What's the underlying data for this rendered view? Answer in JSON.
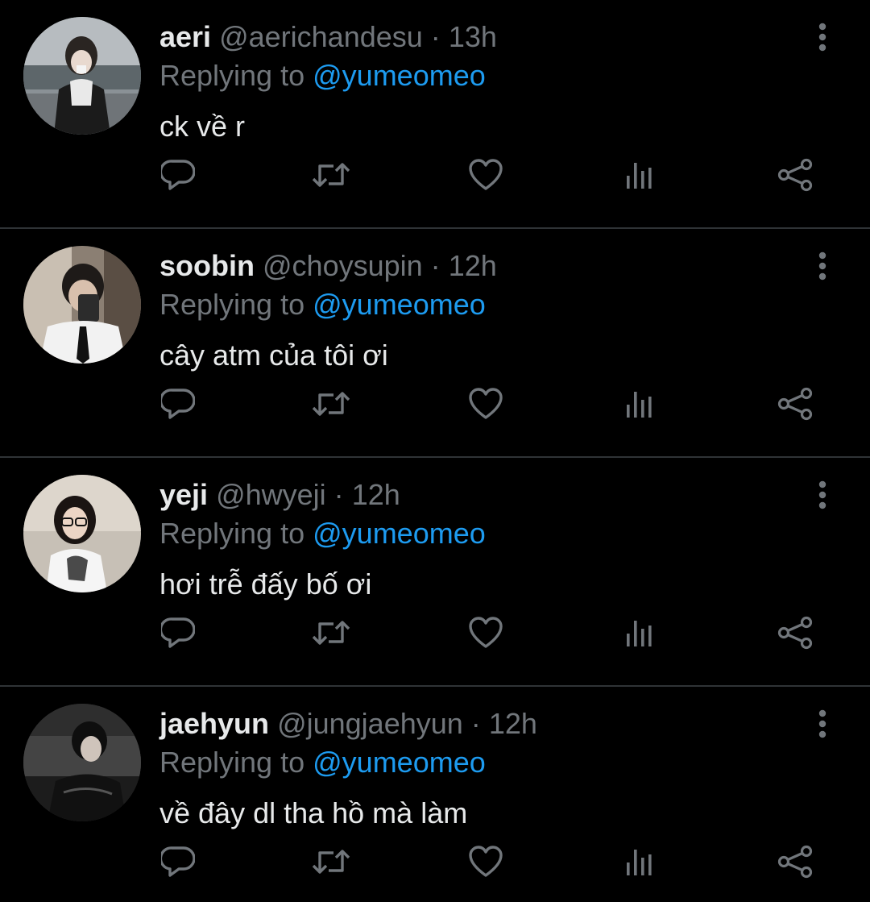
{
  "colors": {
    "background": "#000000",
    "primary_text": "#e7e9ea",
    "secondary_text": "#71767b",
    "mention": "#1d9bf0",
    "divider": "#2f3336"
  },
  "replies": [
    {
      "name": "aeri",
      "handle": "@aerichandesu",
      "separator": "·",
      "time": "13h",
      "replying_prefix": "Replying to",
      "replying_to": "@yumeomeo",
      "text": "ck về r",
      "avatar_icon": "profile-photo"
    },
    {
      "name": "soobin",
      "handle": "@choysupin",
      "separator": "·",
      "time": "12h",
      "replying_prefix": "Replying to",
      "replying_to": "@yumeomeo",
      "text": "cây atm của tôi ơi",
      "avatar_icon": "profile-photo"
    },
    {
      "name": "yeji",
      "handle": "@hwyeji",
      "separator": "·",
      "time": "12h",
      "replying_prefix": "Replying to",
      "replying_to": "@yumeomeo",
      "text": "hơi trễ đấy bố ơi",
      "avatar_icon": "profile-photo"
    },
    {
      "name": "jaehyun",
      "handle": "@jungjaehyun",
      "separator": "·",
      "time": "12h",
      "replying_prefix": "Replying to",
      "replying_to": "@yumeomeo",
      "text": "về đây dl tha hồ mà làm",
      "avatar_icon": "profile-photo"
    }
  ],
  "action_icons": [
    "reply-icon",
    "retweet-icon",
    "like-icon",
    "views-icon",
    "share-icon"
  ],
  "more_icon": "more-vertical-icon"
}
